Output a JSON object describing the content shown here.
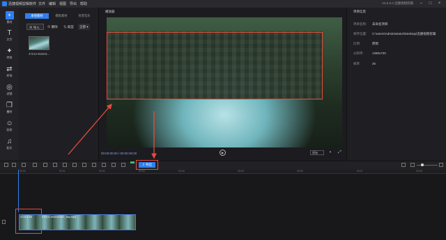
{
  "app": {
    "title": "迅捷视频剪辑软件",
    "version": "V4.5.0.0 迅捷视频剪辑"
  },
  "menu": [
    "文件",
    "编辑",
    "视图",
    "导出",
    "帮助"
  ],
  "window_controls": [
    "minimize",
    "maximize",
    "close"
  ],
  "left_nav": [
    {
      "label": "素材",
      "icon": "media-icon",
      "active": true
    },
    {
      "label": "文字",
      "icon": "text-icon"
    },
    {
      "label": "特效",
      "icon": "effects-icon"
    },
    {
      "label": "转场",
      "icon": "transition-icon"
    },
    {
      "label": "滤镜",
      "icon": "filter-icon"
    },
    {
      "label": "叠附",
      "icon": "overlay-icon"
    },
    {
      "label": "贴纸",
      "icon": "sticker-icon"
    },
    {
      "label": "配乐",
      "icon": "music-icon"
    }
  ],
  "media_panel": {
    "tabs": [
      "本地素材",
      "模板素材",
      "背景音乐"
    ],
    "import_label": "导入",
    "delete_label": "删除",
    "filter_label": "类型",
    "filter_value": "全部",
    "clip_label": "47213-451041..."
  },
  "preview": {
    "title": "播放器",
    "time": "00:00:00:00 / 00:00:30:00",
    "ratio": "原始"
  },
  "properties": {
    "title": "项目信息",
    "rows": [
      {
        "key": "项目名称:",
        "value": "未命名项目"
      },
      {
        "key": "保存位置:",
        "value": "C:\\Users\\Administrator\\Desktop\\迅捷视频剪辑"
      },
      {
        "key": "比例:",
        "value": "原始"
      },
      {
        "key": "分辨率:",
        "value": "1280x720"
      },
      {
        "key": "帧率:",
        "value": "25"
      }
    ]
  },
  "timeline": {
    "export_label": "导出",
    "ticks": [
      "00:00",
      "00:01",
      "00:02",
      "00:03",
      "00:04",
      "00:05",
      "00:06",
      "00:07",
      "00:08"
    ],
    "track_label_1": "47213-45",
    "track_label_2": "47213-451041047_tiny.mp4"
  },
  "colors": {
    "accent": "#2f7ff0",
    "annotation": "#e74c3c"
  }
}
